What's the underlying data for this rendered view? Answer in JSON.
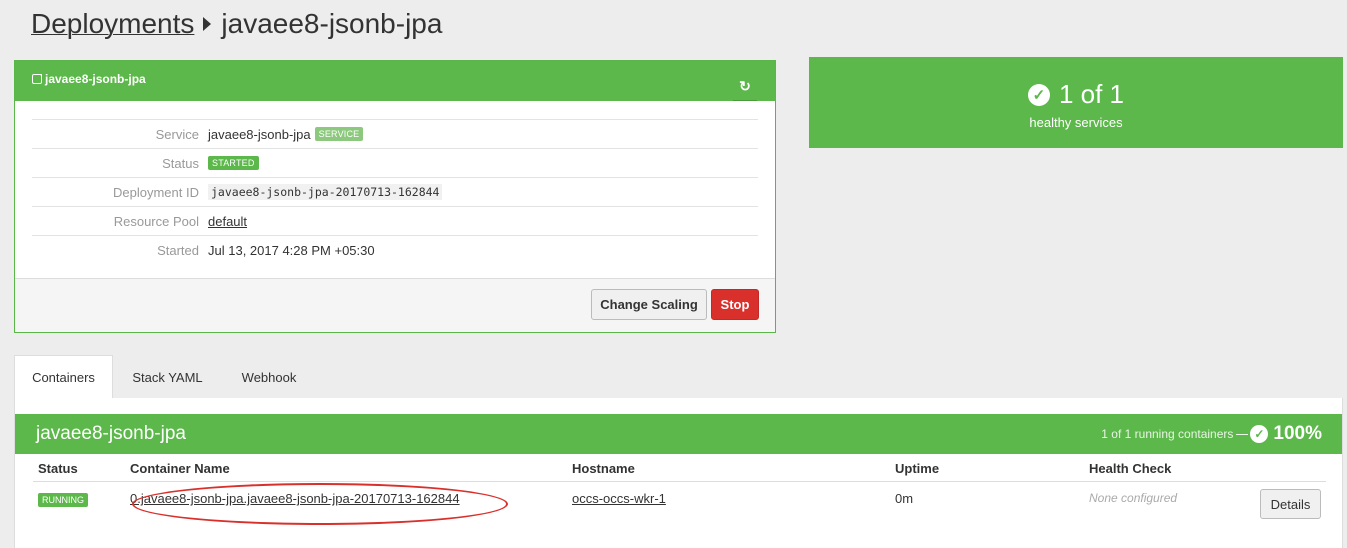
{
  "breadcrumb": {
    "root": "Deployments",
    "current": "javaee8-jsonb-jpa"
  },
  "deployment_panel": {
    "title": "javaee8-jsonb-jpa",
    "refresh_icon": "refresh-icon",
    "rows": {
      "service": {
        "label": "Service",
        "value": "javaee8-jsonb-jpa",
        "badge": "SERVICE"
      },
      "status": {
        "label": "Status",
        "badge": "STARTED"
      },
      "deployment_id": {
        "label": "Deployment ID",
        "value": "javaee8-jsonb-jpa-20170713-162844"
      },
      "resource_pool": {
        "label": "Resource Pool",
        "value": "default"
      },
      "started": {
        "label": "Started",
        "value": "Jul 13, 2017 4:28 PM +05:30"
      }
    },
    "buttons": {
      "change_scaling": "Change Scaling",
      "stop": "Stop"
    }
  },
  "health": {
    "headline": "1 of 1",
    "caption": "healthy services",
    "icon": "check-circle-icon"
  },
  "tabs": [
    {
      "label": "Containers",
      "active": true
    },
    {
      "label": "Stack YAML",
      "active": false
    },
    {
      "label": "Webhook",
      "active": false
    }
  ],
  "service_summary": {
    "name": "javaee8-jsonb-jpa",
    "running": "1 of 1 running containers",
    "percent": "100%"
  },
  "table": {
    "headers": {
      "status": "Status",
      "name": "Container Name",
      "hostname": "Hostname",
      "uptime": "Uptime",
      "health": "Health Check"
    },
    "rows": [
      {
        "status": "RUNNING",
        "name": "0.javaee8-jsonb-jpa.javaee8-jsonb-jpa-20170713-162844",
        "hostname": "occs-occs-wkr-1",
        "uptime": "0m",
        "health": "None configured",
        "action": "Details"
      }
    ]
  },
  "colors": {
    "green": "#5cb84a",
    "red": "#d9302c"
  }
}
